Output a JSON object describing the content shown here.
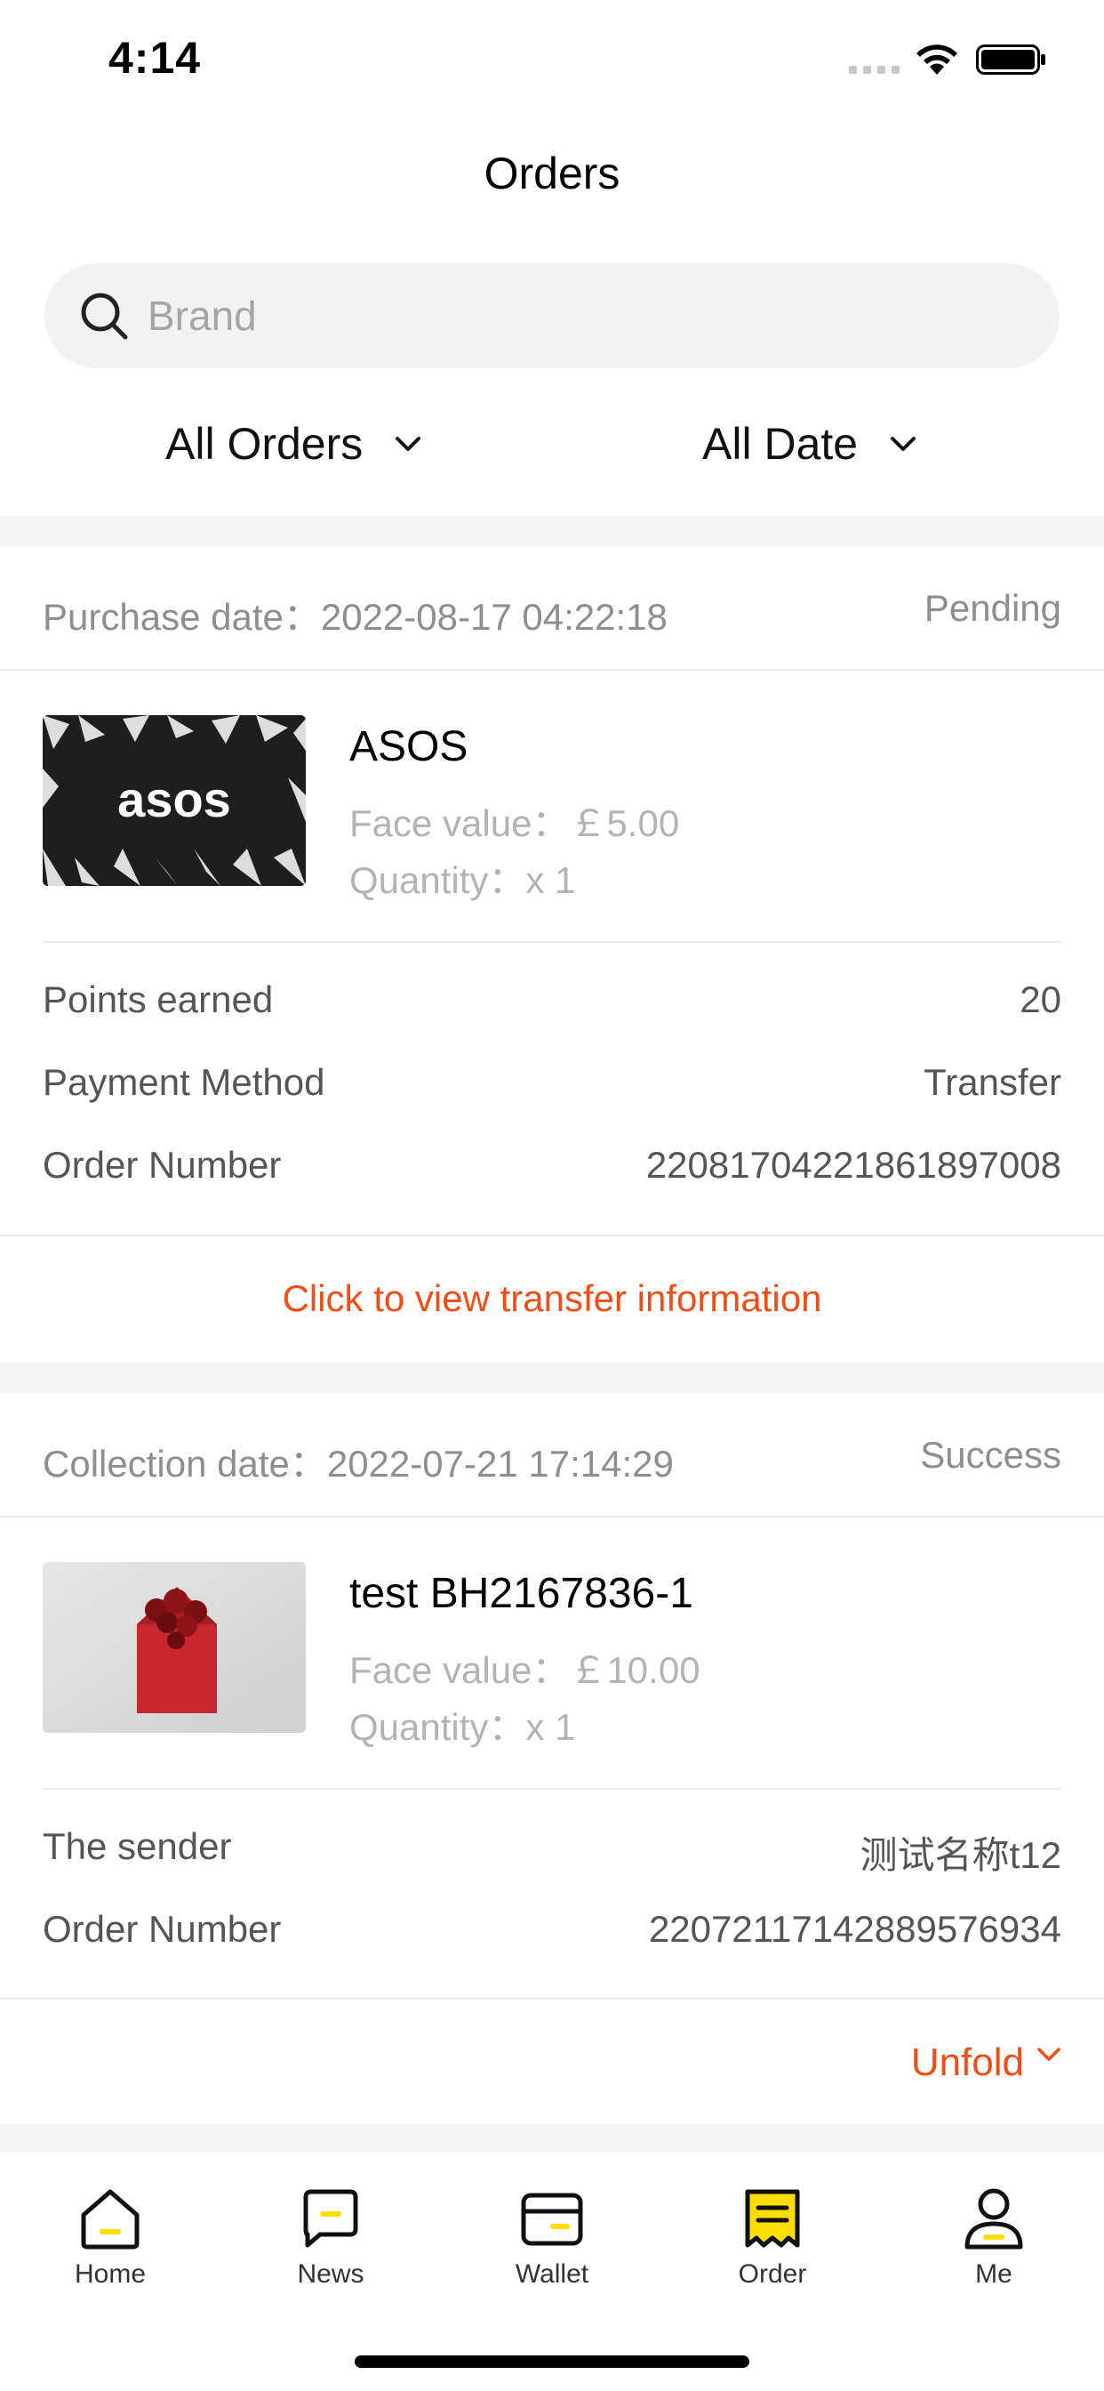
{
  "status_bar": {
    "time": "4:14"
  },
  "header": {
    "title": "Orders"
  },
  "search": {
    "placeholder": "Brand"
  },
  "filters": {
    "orders_label": "All Orders",
    "date_label": "All Date"
  },
  "orders": [
    {
      "date_label": "Purchase date：2022-08-17 04:22:18",
      "status": "Pending",
      "product_image": "asos-gift-card",
      "product_name": "ASOS",
      "face_value": "Face value：￡5.00",
      "quantity": "Quantity：x 1",
      "rows": [
        {
          "label": "Points earned",
          "value": "20"
        },
        {
          "label": "Payment Method",
          "value": "Transfer"
        },
        {
          "label": "Order Number",
          "value": "22081704221861897008"
        }
      ],
      "action": "Click to view transfer information"
    },
    {
      "date_label": "Collection date：2022-07-21 17:14:29",
      "status": "Success",
      "product_image": "red-envelope-with-roses",
      "product_name": "test BH2167836-1",
      "face_value": "Face value：￡10.00",
      "quantity": "Quantity：x 1",
      "rows": [
        {
          "label": "The sender",
          "value": "测试名称t12"
        },
        {
          "label": "Order Number",
          "value": "22072117142889576934"
        }
      ],
      "action": "Unfold"
    }
  ],
  "tabbar": {
    "items": [
      {
        "label": "Home",
        "icon": "home-icon",
        "active": false
      },
      {
        "label": "News",
        "icon": "chat-icon",
        "active": false
      },
      {
        "label": "Wallet",
        "icon": "wallet-icon",
        "active": false
      },
      {
        "label": "Order",
        "icon": "order-icon",
        "active": true
      },
      {
        "label": "Me",
        "icon": "profile-icon",
        "active": false
      }
    ]
  },
  "colors": {
    "accent": "#f14d14",
    "highlight": "#ffdd00",
    "muted_text": "#8e8e8e",
    "separator": "#f4f4f4"
  }
}
